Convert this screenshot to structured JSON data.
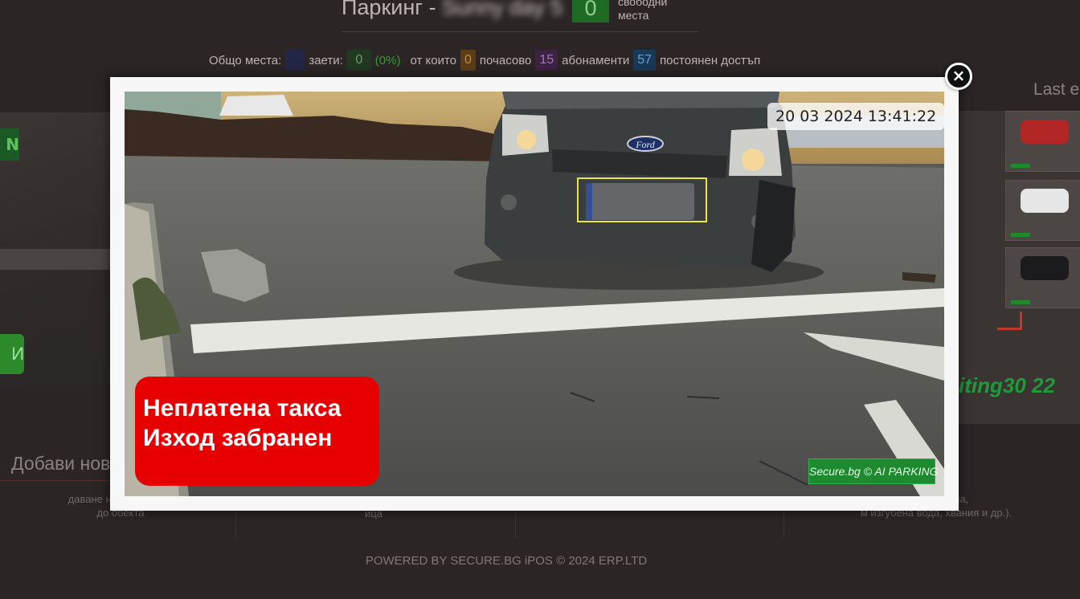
{
  "header": {
    "title_prefix": "Паркинг -",
    "title_name_blurred": "Sunny day 5",
    "free_count": "0",
    "free_label_line1": "свободни",
    "free_label_line2": "места"
  },
  "stats": {
    "total_label": "Общо места:",
    "total_value": "",
    "busy_label": "заети:",
    "busy_value": "0",
    "busy_percent": "(0%)",
    "of_which_label": "от които",
    "hourly_value": "0",
    "hourly_label": "почасово",
    "subs_value": "15",
    "subs_label": "абонаменти",
    "perm_value": "57",
    "perm_label": "постоянен достъп"
  },
  "left_panel": {
    "cam_tag": "N",
    "button_label": "И"
  },
  "right_panel": {
    "title": "Last e",
    "plate_text": "iting30 22"
  },
  "sections": {
    "add_title": "Добави нов",
    "card1_text_line1": "даване на молба за д",
    "card1_text_line2": "до обекта",
    "card2_text": "ица",
    "card3_text_line1": "съжба ( кола,",
    "card3_text_line2": "м изгубена вода, хвания и др.)."
  },
  "footer": {
    "text": "POWERED BY SECURE.BG iPOS © 2024 ERP.LTD"
  },
  "modal": {
    "close_symbol": "×",
    "timestamp": "20 03 2024 13:41:22",
    "warning_line1": "Неплатена такса",
    "warning_line2": "Изход забранен",
    "watermark": "Secure.bg © AI PARKING",
    "car_brand_logo": "Ford"
  },
  "colors": {
    "page_bg": "#2b2525",
    "warning_bg": "#e60000",
    "watermark_bg": "#1e8a30",
    "plate_box": "#e8e83a"
  }
}
